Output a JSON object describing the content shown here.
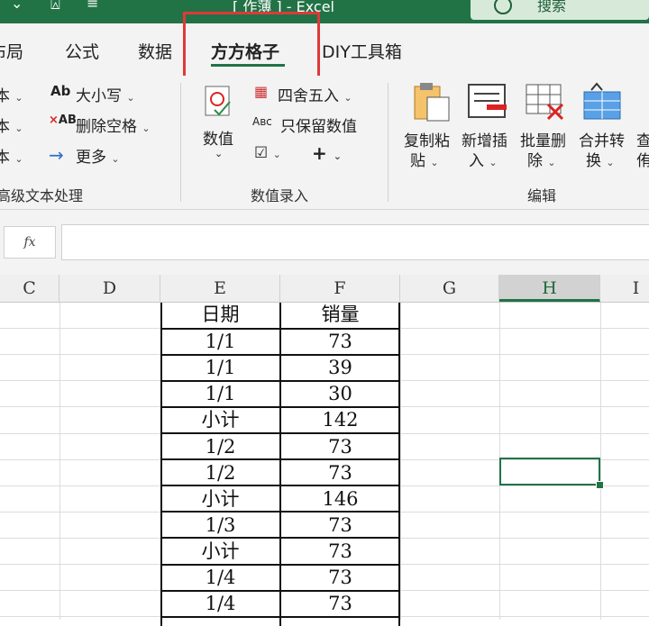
{
  "titlebar": {
    "title": "[ 作薄 ]  -  Excel",
    "search_label": "搜索"
  },
  "tabs": [
    {
      "label": "布局"
    },
    {
      "label": "公式"
    },
    {
      "label": "数据"
    },
    {
      "label": "方方格子"
    },
    {
      "label": "DIY工具箱"
    }
  ],
  "ribbon": {
    "text_group": {
      "case_label": "大小写",
      "remove_spaces_label": "删除空格",
      "more_label": "更多",
      "group_label": "高级文本处理"
    },
    "value_group": {
      "value_label": "数值",
      "round_label": "四舍五入",
      "keep_values_label": "只保留数值",
      "group_label": "数值录入"
    },
    "edit_group": {
      "copy_paste_label": "复制粘贴",
      "insert_label": "新增插入",
      "batch_delete_label": "批量删除",
      "merge_label": "合并转换",
      "group_label": "编辑"
    }
  },
  "columns": [
    "C",
    "D",
    "E",
    "F",
    "G",
    "H",
    "I"
  ],
  "table": {
    "headers": [
      "日期",
      "销量"
    ],
    "rows": [
      [
        "1/1",
        "73"
      ],
      [
        "1/1",
        "39"
      ],
      [
        "1/1",
        "30"
      ],
      [
        "小计",
        "142"
      ],
      [
        "1/2",
        "73"
      ],
      [
        "1/2",
        "73"
      ],
      [
        "小计",
        "146"
      ],
      [
        "1/3",
        "73"
      ],
      [
        "小计",
        "73"
      ],
      [
        "1/4",
        "73"
      ],
      [
        "1/4",
        "73"
      ]
    ]
  },
  "colors": {
    "accent": "#217346",
    "highlight": "#e0393a"
  }
}
